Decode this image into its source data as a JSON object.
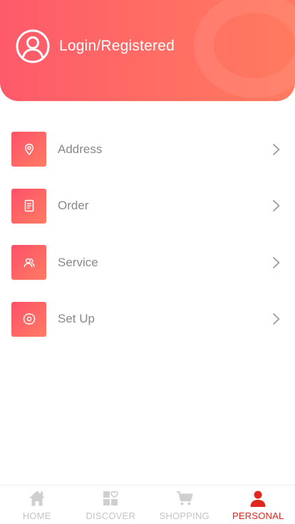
{
  "header": {
    "login_label": "Login/Registered"
  },
  "menu": {
    "items": [
      {
        "label": "Address",
        "icon": "location-pin-icon"
      },
      {
        "label": "Order",
        "icon": "document-icon"
      },
      {
        "label": "Service",
        "icon": "people-icon"
      },
      {
        "label": "Set Up",
        "icon": "gear-icon"
      }
    ]
  },
  "tabbar": {
    "tabs": [
      {
        "label": "HOME",
        "icon": "home-icon",
        "active": false
      },
      {
        "label": "DISCOVER",
        "icon": "discover-icon",
        "active": false
      },
      {
        "label": "SHOPPING",
        "icon": "cart-icon",
        "active": false
      },
      {
        "label": "PERSONAL",
        "icon": "person-icon",
        "active": true
      }
    ]
  },
  "colors": {
    "accent_gradient_start": "#fe5a6a",
    "accent_gradient_end": "#ff7a5f",
    "active_tab": "#e0261d",
    "inactive_tab": "#c4c4c4",
    "menu_text": "#888888"
  }
}
